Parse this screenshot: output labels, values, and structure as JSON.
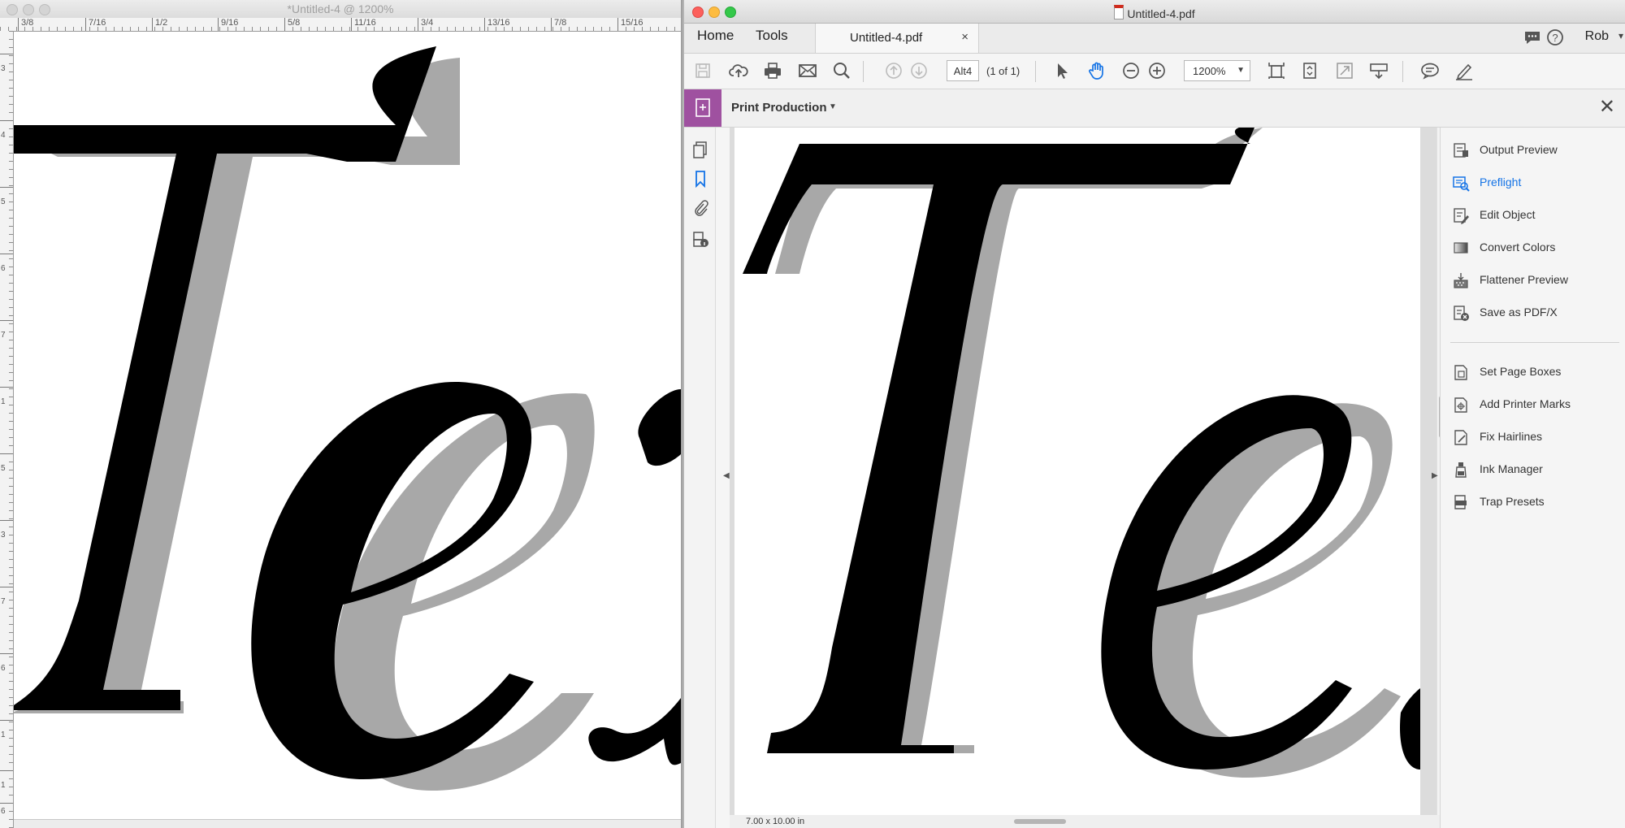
{
  "left_window": {
    "title": "*Untitled-4 @ 1200%",
    "ruler_labels": [
      "3/8",
      "7/16",
      "1/2",
      "9/16",
      "5/8",
      "11/16",
      "3/4",
      "13/16",
      "7/8",
      "15/16"
    ],
    "vruler_labels": [
      "3",
      "4",
      "5",
      "6",
      "7",
      "1",
      "5",
      "3",
      "7",
      "6",
      "1",
      "1",
      "6"
    ]
  },
  "right_window": {
    "title": "Untitled-4.pdf",
    "menu": {
      "home": "Home",
      "tools": "Tools"
    },
    "tab": {
      "label": "Untitled-4.pdf",
      "close": "×"
    },
    "user": "Rob",
    "toolbar": {
      "page_field": "Alt4",
      "page_count": "(1 of 1)",
      "zoom": "1200%"
    },
    "task_bar": {
      "tool_name": "Print Production"
    },
    "status": {
      "page_size": "7.00 x 10.00 in"
    },
    "panel": {
      "items": [
        {
          "label": "Output Preview",
          "icon": "output-preview-icon",
          "active": false
        },
        {
          "label": "Preflight",
          "icon": "preflight-icon",
          "active": true
        },
        {
          "label": "Edit Object",
          "icon": "edit-object-icon",
          "active": false
        },
        {
          "label": "Convert Colors",
          "icon": "convert-colors-icon",
          "active": false
        },
        {
          "label": "Flattener Preview",
          "icon": "flattener-preview-icon",
          "active": false
        },
        {
          "label": "Save as PDF/X",
          "icon": "save-pdfx-icon",
          "active": false
        },
        {
          "label": "Set Page Boxes",
          "icon": "set-page-boxes-icon",
          "active": false
        },
        {
          "label": "Add Printer Marks",
          "icon": "printer-marks-icon",
          "active": false
        },
        {
          "label": "Fix Hairlines",
          "icon": "fix-hairlines-icon",
          "active": false
        },
        {
          "label": "Ink Manager",
          "icon": "ink-manager-icon",
          "active": false
        },
        {
          "label": "Trap Presets",
          "icon": "trap-presets-icon",
          "active": false
        }
      ]
    }
  },
  "colors": {
    "accent": "#1473e6",
    "tool_badge": "#9f51a0",
    "glyph": "#000000",
    "shadow": "#a8a8a8"
  }
}
